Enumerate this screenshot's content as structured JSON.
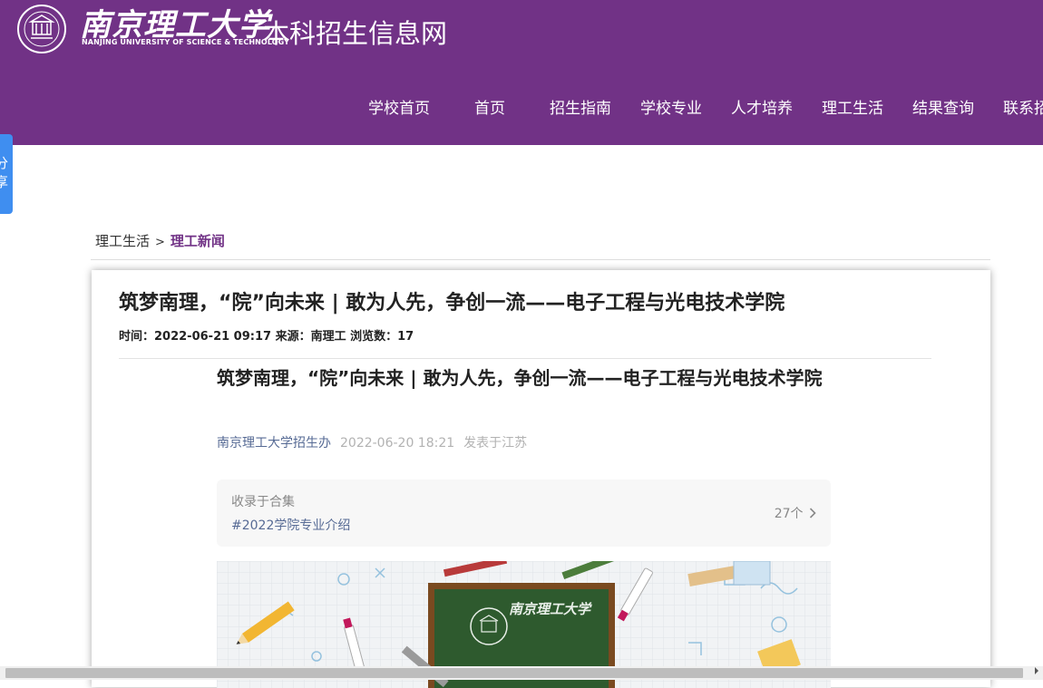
{
  "header": {
    "logo_cn": "南京理工大学",
    "logo_en": "NANJING UNIVERSITY OF SCIENCE & TECHNOLOGY",
    "site_name": "本科招生信息网",
    "brand_color": "#713286"
  },
  "nav": {
    "items": [
      {
        "label": "学校首页"
      },
      {
        "label": "首页"
      },
      {
        "label": "招生指南"
      },
      {
        "label": "学校专业"
      },
      {
        "label": "人才培养"
      },
      {
        "label": "理工生活"
      },
      {
        "label": "结果查询"
      },
      {
        "label": "联系招生办"
      }
    ]
  },
  "share": {
    "char1": "分",
    "char2": "享",
    "color": "#3f8ef0"
  },
  "breadcrumb": {
    "parent": "理工生活",
    "separator": ">",
    "current": "理工新闻"
  },
  "article": {
    "title": "筑梦南理，“院”向未来 | 敢为人先，争创一流——电子工程与光电技术学院",
    "meta": "时间：2022-06-21 09:17 来源：南理工 浏览数：17"
  },
  "wechat": {
    "title": "筑梦南理，“院”向未来 | 敢为人先，争创一流——电子工程与光电技术学院",
    "author": "南京理工大学招生办",
    "date": "2022-06-20 18:21",
    "location": "发表于江苏",
    "collection_label": "收录于合集",
    "collection_tag": "#2022学院专业介绍",
    "collection_count": "27个",
    "chalkboard_text": "南京理工大学"
  },
  "icons": {
    "chevron": "chevron-right-icon",
    "scroll_right": "scroll-right-arrow-icon"
  }
}
